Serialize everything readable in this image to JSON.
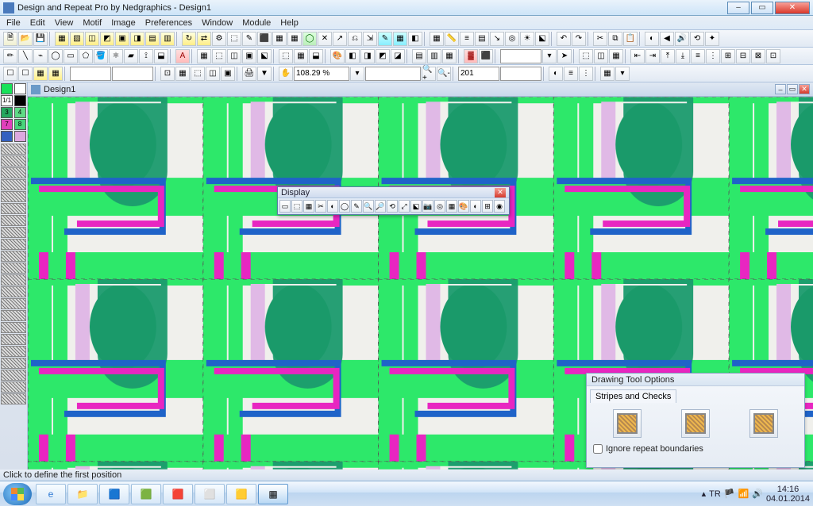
{
  "titlebar": {
    "title": "Design and Repeat Pro by Nedgraphics - Design1"
  },
  "menu": [
    "File",
    "Edit",
    "View",
    "Motif",
    "Image",
    "Preferences",
    "Window",
    "Module",
    "Help"
  ],
  "toolbar2": {
    "zoom": "108.29 %",
    "num": "201"
  },
  "doc": {
    "title": "Design1"
  },
  "float_display": {
    "title": "Display"
  },
  "options": {
    "title": "Drawing Tool Options",
    "tab": "Stripes and Checks",
    "checkbox": "Ignore repeat boundaries"
  },
  "status": "Click to define the first position",
  "swatches": [
    {
      "c": "#18e25a"
    },
    {
      "c": "#ffffff"
    },
    {
      "c": "#ffffff",
      "t": "1/1"
    },
    {
      "c": "#000000"
    },
    {
      "c": "#25a85f",
      "t": "3"
    },
    {
      "c": "#5fdb86",
      "t": "4"
    },
    {
      "c": "#e03fbb",
      "t": "7"
    },
    {
      "c": "#48d47b",
      "t": "8"
    },
    {
      "c": "#3360c0"
    },
    {
      "c": "#dca8e0"
    }
  ],
  "tray": {
    "lang": "TR",
    "time": "14:16",
    "date": "04.01.2014"
  }
}
